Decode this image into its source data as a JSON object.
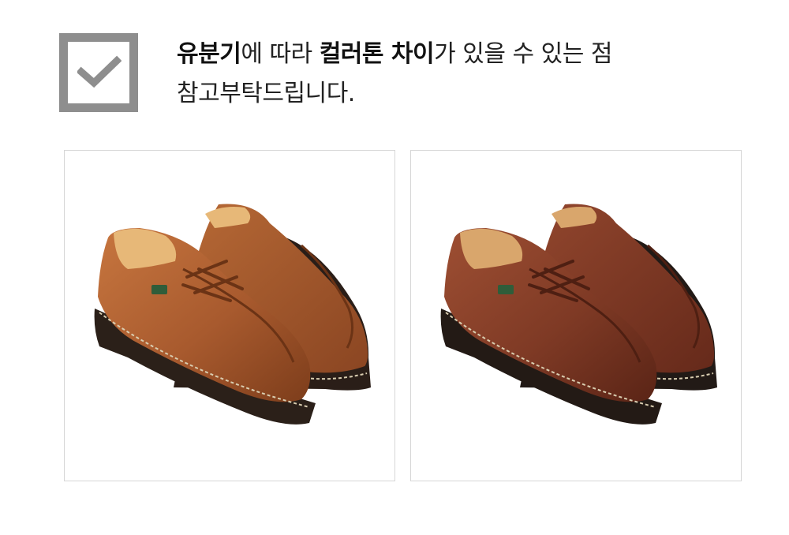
{
  "notice": {
    "line1": [
      {
        "text": "유분기",
        "bold": true
      },
      {
        "text": "에 따라 ",
        "bold": false
      },
      {
        "text": "컬러톤 차이",
        "bold": true
      },
      {
        "text": "가 있을 수 있는 점",
        "bold": false
      }
    ],
    "line2": "참고부탁드립니다.",
    "check_icon": "checkmark-icon"
  },
  "photos": [
    {
      "name": "shoe-photo-light",
      "tone": "#a85a2e"
    },
    {
      "name": "shoe-photo-dark",
      "tone": "#7f3a25"
    }
  ],
  "colors": {
    "checkbox_border": "#8e8e8e",
    "text": "#222222",
    "photo_border": "#d6d6d6"
  }
}
